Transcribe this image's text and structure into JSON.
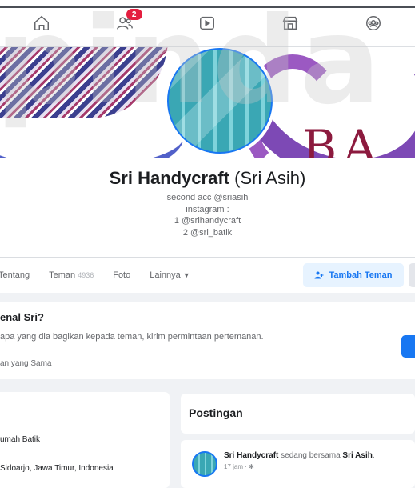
{
  "nav": {
    "items": [
      "home-icon",
      "friends-icon",
      "watch-icon",
      "marketplace-icon",
      "groups-icon"
    ],
    "friends_badge": "2"
  },
  "profile": {
    "name": "Sri Handycraft",
    "alt_name": "(Sri Asih)",
    "bio": [
      "second acc @sriasih",
      "instagram :",
      "1 @srihandycraft",
      "2 @sri_batik"
    ]
  },
  "tabs": {
    "about": "Tentang",
    "friends": "Teman",
    "friends_count": "4936",
    "photos": "Foto",
    "more": "Lainnya",
    "add_friend": "Tambah Teman"
  },
  "know": {
    "title": "enal Sri?",
    "text": "apa yang dia bagikan kepada teman, kirim permintaan pertemanan.",
    "sub": "an yang Sama"
  },
  "intro": {
    "rows": [
      "umah Batik",
      "Sidoarjo, Jawa Timur, Indonesia"
    ]
  },
  "posts": {
    "title": "Postingan",
    "author": "Sri Handycraft",
    "action": "sedang bersama",
    "with": "Sri Asih",
    "time": "17 jam"
  },
  "colors": {
    "accent": "#1877f2",
    "badge": "#e41e3f"
  }
}
